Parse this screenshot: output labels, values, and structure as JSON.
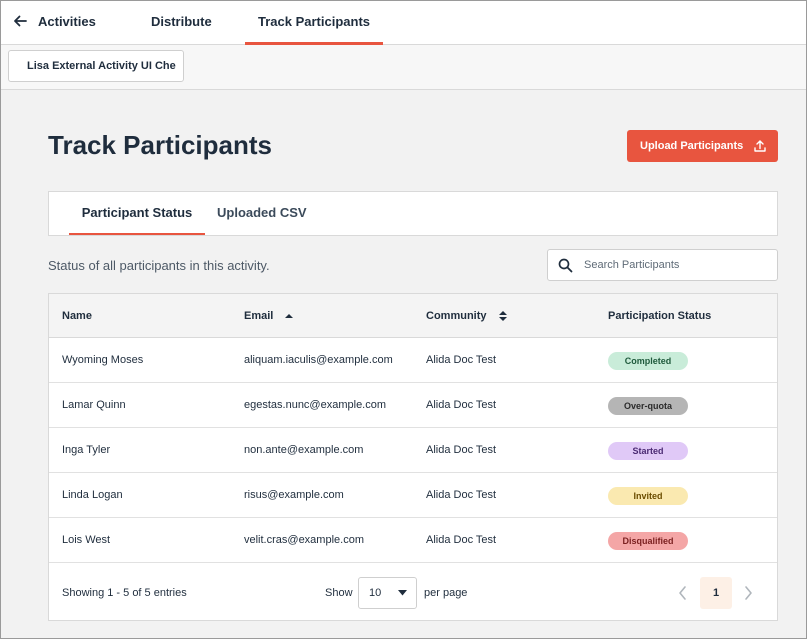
{
  "nav": {
    "activities": "Activities",
    "distribute": "Distribute",
    "track": "Track Participants"
  },
  "activity_select": "Lisa External Activity UI Che",
  "page_title": "Track Participants",
  "upload_button": "Upload Participants",
  "tabs": [
    "Participant Status",
    "Uploaded CSV"
  ],
  "description": "Status of all participants in this activity.",
  "search": {
    "placeholder": "Search Participants",
    "value": ""
  },
  "table": {
    "headers": [
      "Name",
      "Email",
      "Community",
      "Participation Status"
    ],
    "rows": [
      {
        "name": "Wyoming Moses",
        "email": "aliquam.iaculis@example.com",
        "community": "Alida Doc Test",
        "status": "Completed"
      },
      {
        "name": "Lamar Quinn",
        "email": "egestas.nunc@example.com",
        "community": "Alida Doc Test",
        "status": "Over-quota"
      },
      {
        "name": "Inga Tyler",
        "email": "non.ante@example.com",
        "community": "Alida Doc Test",
        "status": "Started"
      },
      {
        "name": "Linda Logan",
        "email": "risus@example.com",
        "community": "Alida Doc Test",
        "status": "Invited"
      },
      {
        "name": "Lois West",
        "email": "velit.cras@example.com",
        "community": "Alida Doc Test",
        "status": "Disqualified"
      }
    ]
  },
  "status_colors": {
    "Completed": {
      "bg": "#c9ecd9",
      "fg": "#1f5a3c"
    },
    "Over-quota": {
      "bg": "#b5b5b5",
      "fg": "#2b2b2b"
    },
    "Started": {
      "bg": "#e0c9f7",
      "fg": "#4b2a73"
    },
    "Invited": {
      "bg": "#fae9b0",
      "fg": "#6b4d00"
    },
    "Disqualified": {
      "bg": "#f4a6a6",
      "fg": "#7a1f1f"
    }
  },
  "footer": {
    "entries": "Showing 1 - 5 of 5 entries",
    "show_label": "Show",
    "per_page_value": "10",
    "per_page_label": "per page",
    "current_page": "1"
  },
  "accent_color": "#e8553f"
}
